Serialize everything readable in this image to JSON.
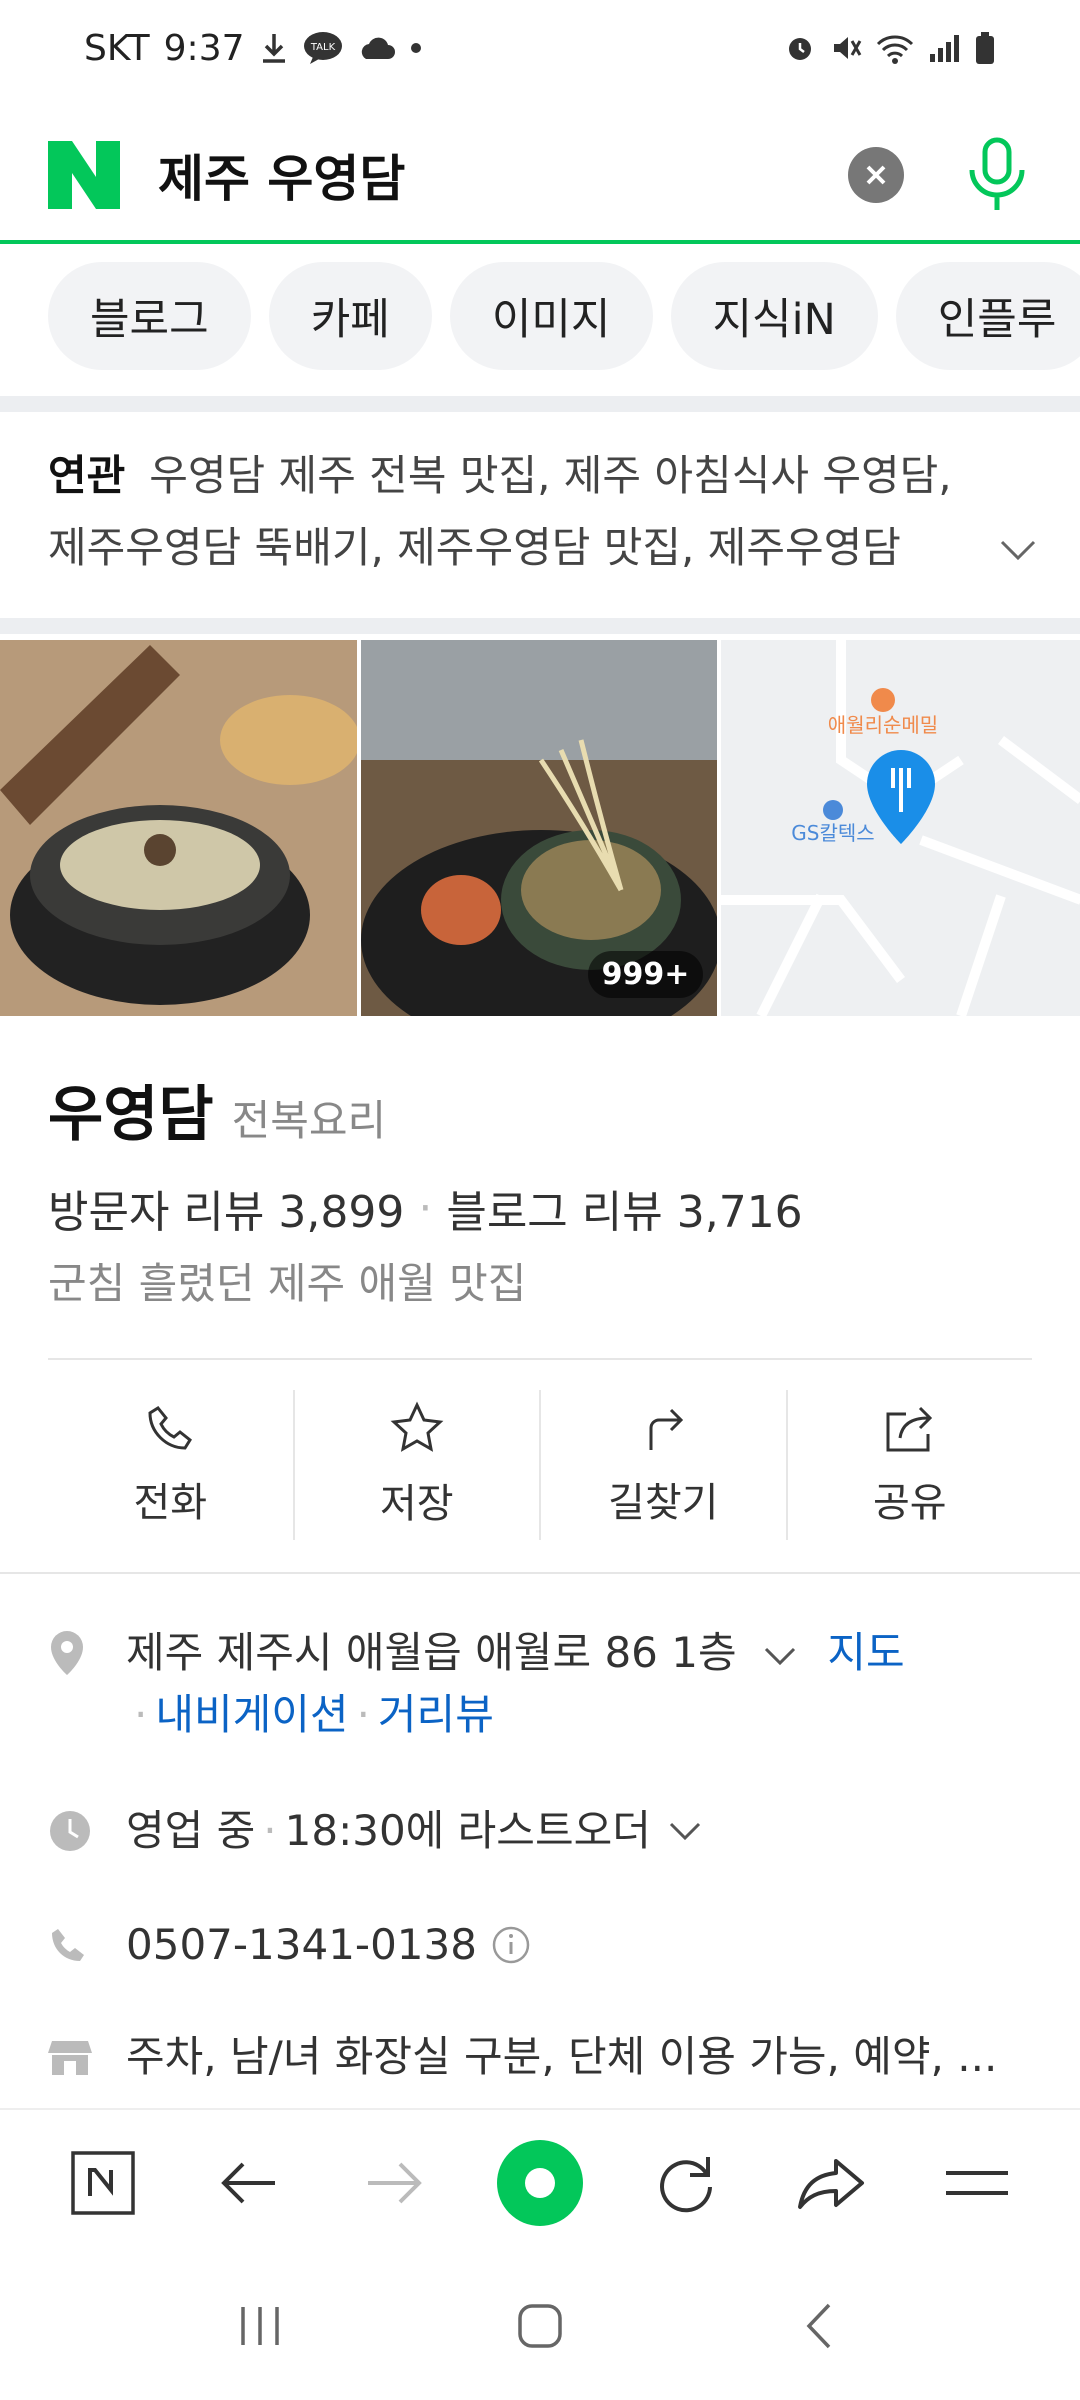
{
  "status_bar": {
    "carrier": "SKT",
    "time": "9:37",
    "talk_badge": "TALK"
  },
  "search": {
    "query": "제주 우영담"
  },
  "tabs": [
    "블로그",
    "카페",
    "이미지",
    "지식iN",
    "인플루"
  ],
  "related": {
    "label": "연관",
    "line1": "우영담 제주 전복 맛집, 제주 아침식사 우영담,",
    "line2": "제주우영담 뚝배기, 제주우영담 맛집, 제주우영담"
  },
  "images": {
    "count_badge": "999+",
    "map_label_gas": "GS칼텍스",
    "map_label_restaurant": "애월리순메밀"
  },
  "place": {
    "name": "우영담",
    "category": "전복요리",
    "visitor_reviews": "방문자 리뷰 3,899",
    "blog_reviews": "블로그 리뷰 3,716",
    "tagline": "군침 흘렸던 제주 애월 맛집"
  },
  "actions": [
    "전화",
    "저장",
    "길찾기",
    "공유"
  ],
  "details": {
    "address": "제주 제주시 애월읍 애월로 86 1층",
    "map_link": "지도",
    "navigation_link": "내비게이션",
    "street_view_link": "거리뷰",
    "status": "영업 중",
    "last_order": "18:30에 라스트오더",
    "phone": "0507-1341-0138",
    "amenities": "주차, 남/녀 화장실 구분, 단체 이용 가능, 예약, ..."
  },
  "colors": {
    "naver_green": "#03c75a",
    "link_blue": "#0b63c5"
  }
}
